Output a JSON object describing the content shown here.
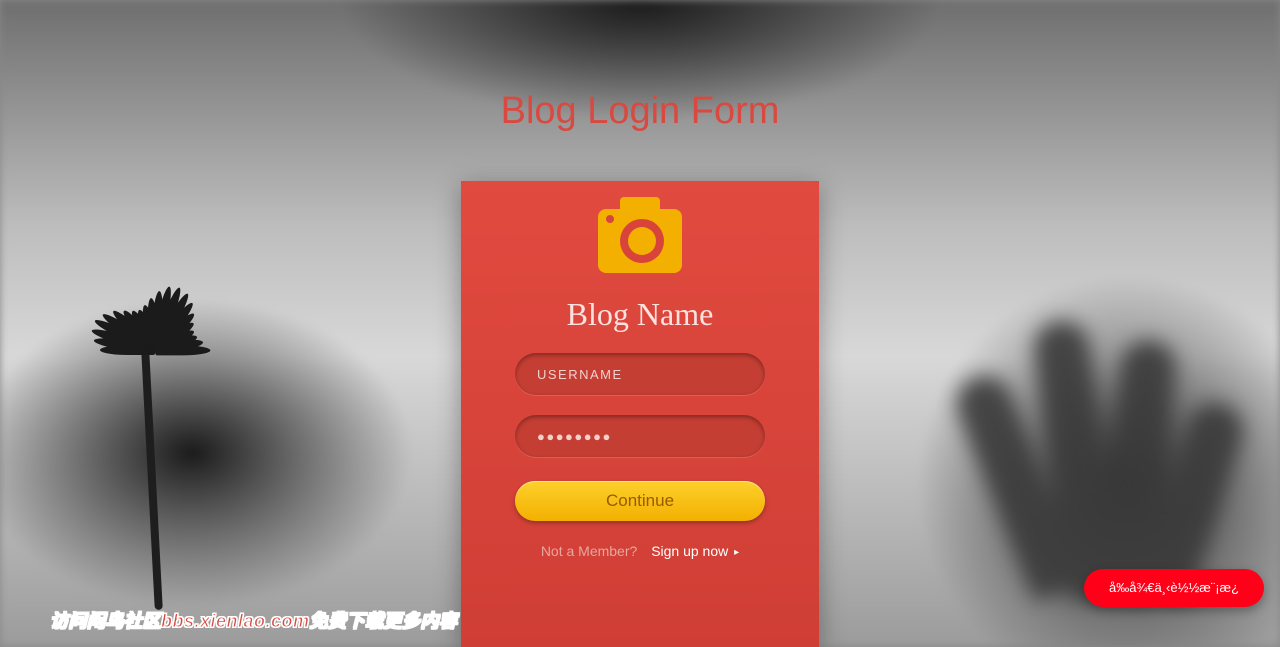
{
  "page": {
    "title": "Blog Login Form"
  },
  "card": {
    "logo_icon": "camera-icon",
    "heading": "Blog Name",
    "username": {
      "placeholder": "USERNAME",
      "value": ""
    },
    "password": {
      "placeholder": "●●●●●●●●",
      "value": ""
    },
    "continue_label": "Continue",
    "not_member_label": "Not a Member?",
    "signup_label": "Sign up now",
    "signup_caret": "▸"
  },
  "footer": {
    "promo_text": "访问闲鸟社区bbs.xienlao.com免费下载更多内容"
  },
  "fab": {
    "label": "å‰å¾€ä¸‹è½½æ¨¡æ¿"
  },
  "colors": {
    "accent": "#d9493f",
    "card_bg": "#d8443a",
    "button": "#f3b000",
    "fab": "#ff0018"
  }
}
